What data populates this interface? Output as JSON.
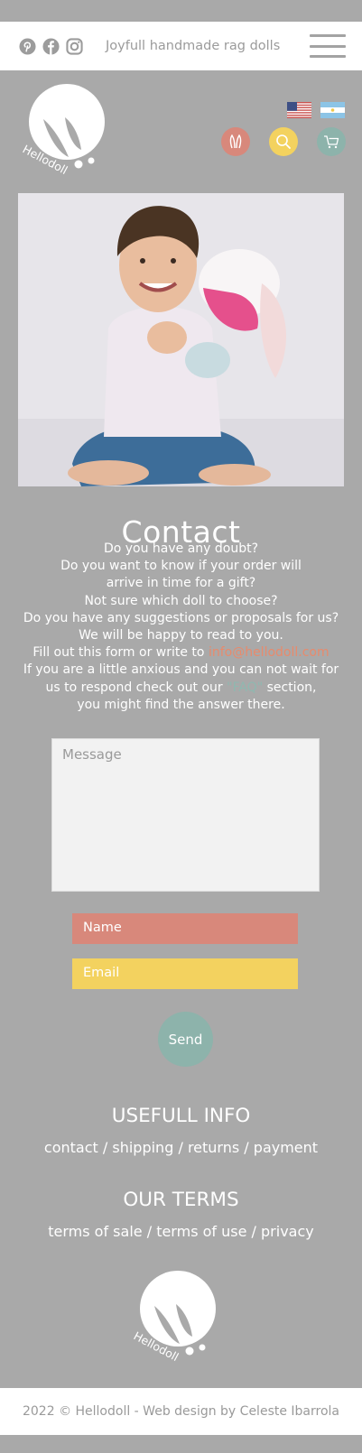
{
  "header": {
    "tagline": "Joyfull handmade rag dolls",
    "social": [
      "pinterest-icon",
      "facebook-icon",
      "instagram-icon"
    ],
    "menu_icon": "hamburger-menu-icon"
  },
  "logo": {
    "text": "Hellodoll"
  },
  "languages": [
    "us-flag",
    "argentina-flag"
  ],
  "nav_icons": [
    "bunny-ears-icon",
    "search-icon",
    "cart-icon"
  ],
  "colors": {
    "background": "#a9a9a9",
    "coral": "#d8887b",
    "yellow": "#f3d25f",
    "teal": "#8db3ab"
  },
  "contact": {
    "title": "Contact",
    "lines": [
      "Do you have any doubt?",
      "Do you want to know if your order will",
      "arrive in time for a gift?",
      "Not sure which doll to choose?",
      "Do you have any suggestions or proposals for us?",
      "We will be happy to read to you."
    ],
    "line7_pre": "Fill out this form or write to ",
    "email": "info@hellodoll.com",
    "line8": "If you are a little anxious and you can not wait for",
    "line9_pre": "us to respond check out our ",
    "faq": "\"FAQ\"",
    "line9_post": " section,",
    "line10": "you might find the answer there."
  },
  "form": {
    "message_placeholder": "Message",
    "name_placeholder": "Name",
    "email_placeholder": "Email",
    "send_label": "Send"
  },
  "useful_info": {
    "title": "USEFULL INFO",
    "links": [
      "contact",
      "shipping",
      "returns",
      "payment"
    ]
  },
  "terms": {
    "title": "OUR TERMS",
    "links": [
      "terms of sale",
      "terms of use",
      "privacy"
    ]
  },
  "footer": {
    "text": "2022 © Hellodoll - Web design by Celeste Ibarrola"
  }
}
